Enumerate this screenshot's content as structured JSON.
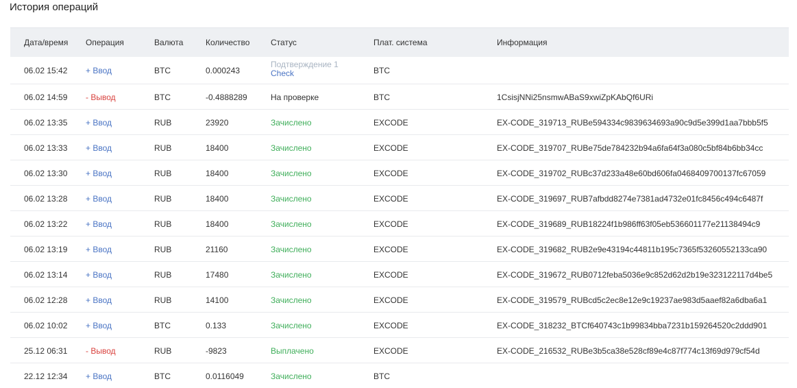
{
  "page": {
    "title": "История операций"
  },
  "colors": {
    "income": "#4a74c4",
    "outcome": "#d9423e",
    "success": "#3fae5a",
    "pending": "#a9b4c2",
    "header_bg": "#eef0f3"
  },
  "table": {
    "headers": [
      "Дата/время",
      "Операция",
      "Валюта",
      "Количество",
      "Статус",
      "Плат. система",
      "Информация"
    ],
    "rows": [
      {
        "date": "06.02 15:42",
        "op": "+ Ввод",
        "cur": "BTC",
        "qty": "0.000243",
        "status": "Подтверждение 1",
        "status_link": "Check",
        "ps": "BTC",
        "info": ""
      },
      {
        "date": "06.02 14:59",
        "op": "- Вывод",
        "cur": "BTC",
        "qty": "-0.4888289",
        "status": "На проверке",
        "ps": "BTC",
        "info": "1CsisjNNi25nsmwABaS9xwiZpKAbQf6URi"
      },
      {
        "date": "06.02 13:35",
        "op": "+ Ввод",
        "cur": "RUB",
        "qty": "23920",
        "status": "Зачислено",
        "ps": "EXCODE",
        "info": "EX-CODE_319713_RUBe594334c9839634693a90c9d5e399d1aa7bbb5f5"
      },
      {
        "date": "06.02 13:33",
        "op": "+ Ввод",
        "cur": "RUB",
        "qty": "18400",
        "status": "Зачислено",
        "ps": "EXCODE",
        "info": "EX-CODE_319707_RUBe75de784232b94a6fa64f3a080c5bf84b6bb34cc"
      },
      {
        "date": "06.02 13:30",
        "op": "+ Ввод",
        "cur": "RUB",
        "qty": "18400",
        "status": "Зачислено",
        "ps": "EXCODE",
        "info": "EX-CODE_319702_RUBc37d233a48e60bd606fa0468409700137fc67059"
      },
      {
        "date": "06.02 13:28",
        "op": "+ Ввод",
        "cur": "RUB",
        "qty": "18400",
        "status": "Зачислено",
        "ps": "EXCODE",
        "info": "EX-CODE_319697_RUB7afbdd8274e7381ad4732e01fc8456c494c6487f"
      },
      {
        "date": "06.02 13:22",
        "op": "+ Ввод",
        "cur": "RUB",
        "qty": "18400",
        "status": "Зачислено",
        "ps": "EXCODE",
        "info": "EX-CODE_319689_RUB18224f1b986ff63f05eb536601177e21138494c9"
      },
      {
        "date": "06.02 13:19",
        "op": "+ Ввод",
        "cur": "RUB",
        "qty": "21160",
        "status": "Зачислено",
        "ps": "EXCODE",
        "info": "EX-CODE_319682_RUB2e9e43194c44811b195c7365f53260552133ca90"
      },
      {
        "date": "06.02 13:14",
        "op": "+ Ввод",
        "cur": "RUB",
        "qty": "17480",
        "status": "Зачислено",
        "ps": "EXCODE",
        "info": "EX-CODE_319672_RUB0712feba5036e9c852d62d2b19e323122117d4be5"
      },
      {
        "date": "06.02 12:28",
        "op": "+ Ввод",
        "cur": "RUB",
        "qty": "14100",
        "status": "Зачислено",
        "ps": "EXCODE",
        "info": "EX-CODE_319579_RUBcd5c2ec8e12e9c19237ae983d5aaef82a6dba6a1"
      },
      {
        "date": "06.02 10:02",
        "op": "+ Ввод",
        "cur": "BTC",
        "qty": "0.133",
        "status": "Зачислено",
        "ps": "EXCODE",
        "info": "EX-CODE_318232_BTCf640743c1b99834bba7231b159264520c2ddd901"
      },
      {
        "date": "25.12 06:31",
        "op": "- Вывод",
        "cur": "RUB",
        "qty": "-9823",
        "status": "Выплачено",
        "ps": "EXCODE",
        "info": "EX-CODE_216532_RUBe3b5ca38e528cf89e4c87f774c13f69d979cf54d"
      },
      {
        "date": "22.12 12:34",
        "op": "+ Ввод",
        "cur": "BTC",
        "qty": "0.0116049",
        "status": "Зачислено",
        "ps": "BTC",
        "info": ""
      }
    ]
  }
}
